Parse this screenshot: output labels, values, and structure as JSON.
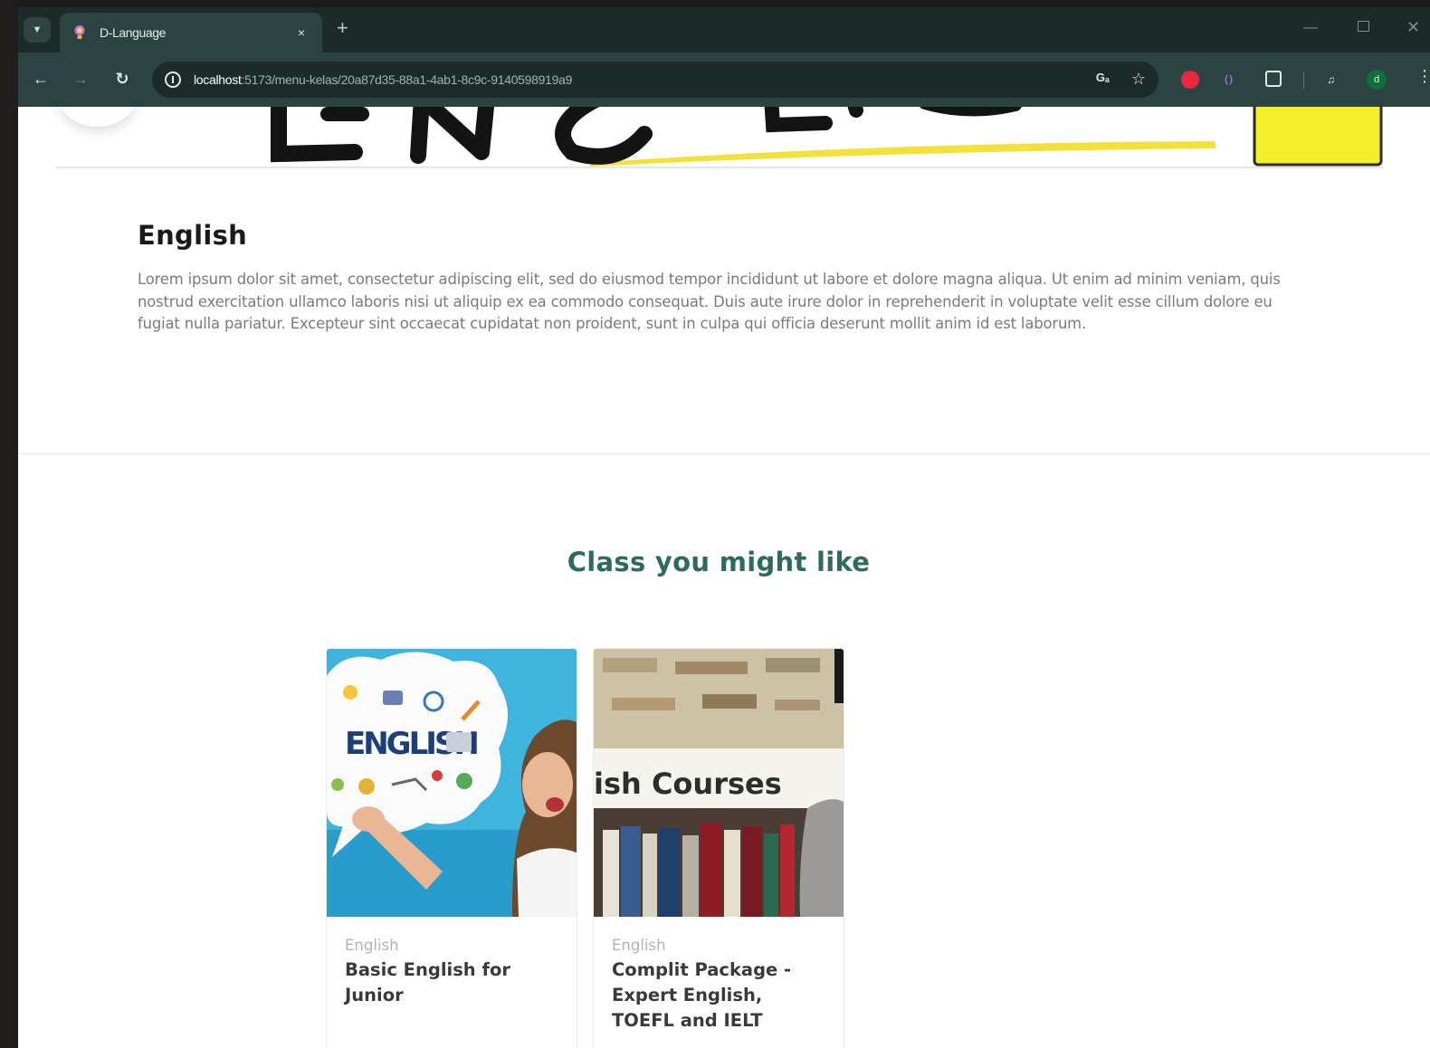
{
  "browser": {
    "tab_title": "D-Language",
    "tab_close": "×",
    "new_tab": "+",
    "url_host": "localhost",
    "url_rest": ":5173/menu-kelas/20a87d35-88a1-4ab1-8c9c-9140598919a9",
    "profile_initial": "d",
    "icons": {
      "back": "arrow-left-icon",
      "forward": "arrow-right-icon",
      "reload": "reload-icon",
      "site_info": "site-info-icon",
      "translate": "translate-icon",
      "bookmark": "star-icon",
      "extensions": "puzzle-icon",
      "menu": "kebab-menu-icon"
    },
    "colors": {
      "titlebar": "#1c2a29",
      "toolbar": "#2b4442"
    }
  },
  "hero": {
    "banner_text": "ENGLISH"
  },
  "language": {
    "title": "English",
    "description": "Lorem ipsum dolor sit amet, consectetur adipiscing elit, sed do eiusmod tempor incididunt ut labore et dolore magna aliqua. Ut enim ad minim veniam, quis nostrud exercitation ullamco laboris nisi ut aliquip ex ea commodo consequat. Duis aute irure dolor in reprehenderit in voluptate velit esse cillum dolore eu fugiat nulla pariatur. Excepteur sint occaecat cupidatat non proident, sunt in culpa qui officia deserunt mollit anim id est laborum."
  },
  "recommendations": {
    "title": "Class you might like",
    "title_color": "#2e6b5e",
    "cards": [
      {
        "image_text": "ENGLISH",
        "category": "English",
        "name": "Basic English for Junior"
      },
      {
        "image_text": "ish Courses",
        "category": "English",
        "name": "Complit Package - Expert English, TOEFL and IELT"
      }
    ]
  }
}
